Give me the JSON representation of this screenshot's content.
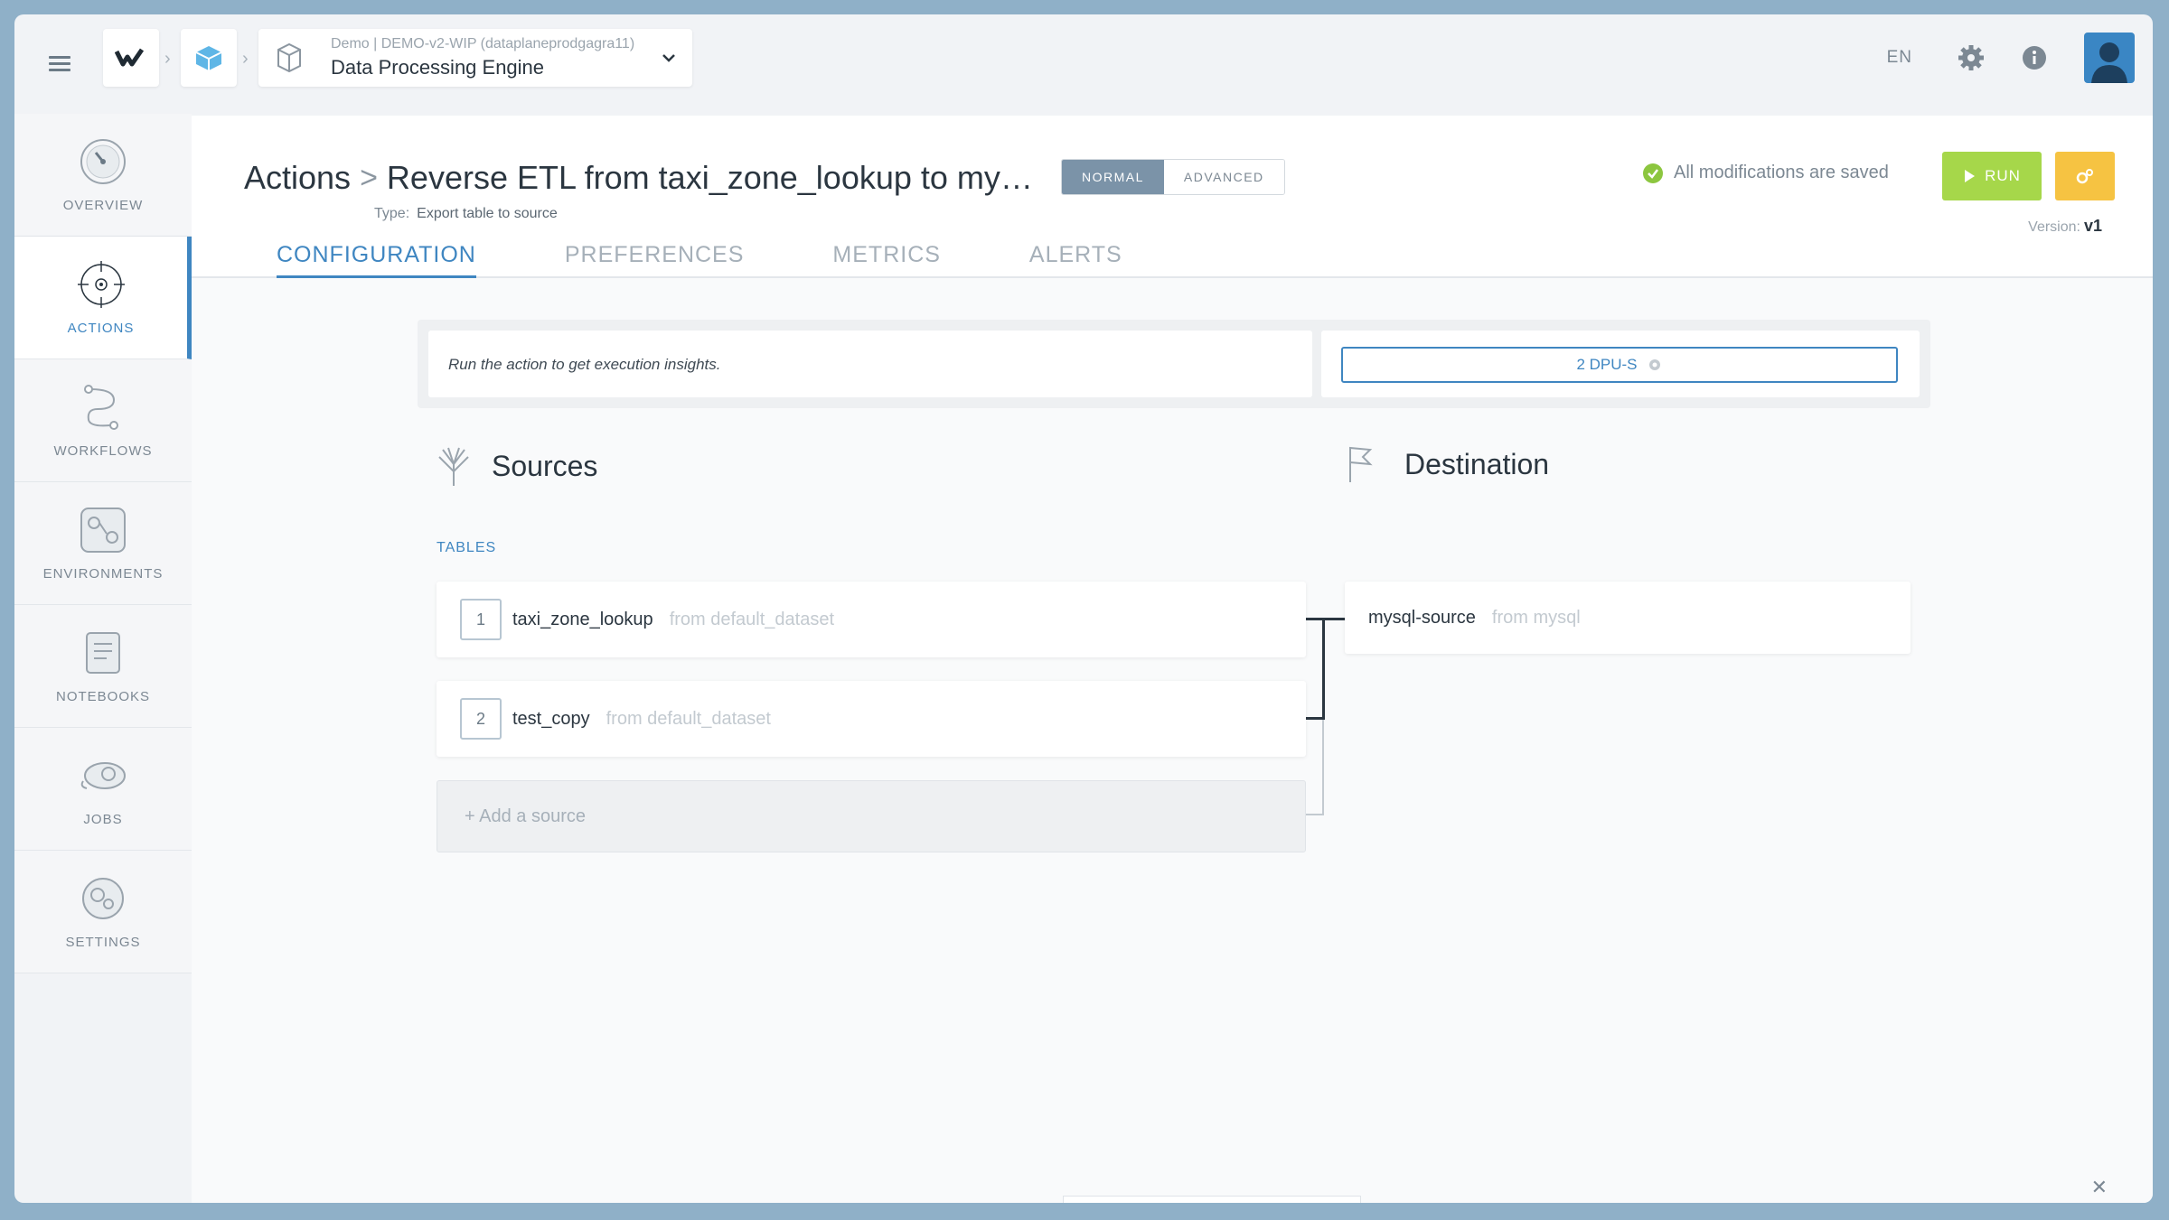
{
  "breadcrumb": {
    "org_sub": "Demo | DEMO-v2-WIP (dataplaneprodgagra11)",
    "project_title": "Data Processing Engine"
  },
  "topbar": {
    "lang": "EN"
  },
  "sidebar": {
    "items": [
      {
        "label": "OVERVIEW",
        "icon": "gauge-icon"
      },
      {
        "label": "ACTIONS",
        "icon": "target-icon",
        "active": true
      },
      {
        "label": "WORKFLOWS",
        "icon": "workflow-icon"
      },
      {
        "label": "ENVIRONMENTS",
        "icon": "environments-icon"
      },
      {
        "label": "NOTEBOOKS",
        "icon": "notebook-icon"
      },
      {
        "label": "JOBS",
        "icon": "jobs-icon"
      },
      {
        "label": "SETTINGS",
        "icon": "settings-gear-icon"
      }
    ]
  },
  "header": {
    "section": "Actions",
    "action_name": "Reverse ETL from taxi_zone_lookup to my…",
    "type_label": "Type:",
    "type_value": "Export table to source",
    "mode_normal": "NORMAL",
    "mode_advanced": "ADVANCED",
    "saved_status": "All modifications are saved",
    "run_label": "RUN",
    "version_label": "Version:",
    "version_value": "v1"
  },
  "tabs": [
    {
      "label": "CONFIGURATION",
      "active": true
    },
    {
      "label": "PREFERENCES"
    },
    {
      "label": "METRICS"
    },
    {
      "label": "ALERTS"
    }
  ],
  "insights": {
    "message": "Run the action to get execution insights.",
    "dpu_label": "2 DPU-S"
  },
  "sources": {
    "title": "Sources",
    "tables_label": "TABLES",
    "items": [
      {
        "num": "1",
        "name": "taxi_zone_lookup",
        "from": "from default_dataset"
      },
      {
        "num": "2",
        "name": "test_copy",
        "from": "from default_dataset"
      }
    ],
    "add_label": "+ Add a source"
  },
  "destination": {
    "title": "Destination",
    "name": "mysql-source",
    "from": "from mysql"
  },
  "colors": {
    "accent": "#3f86c1",
    "run": "#a6d74a",
    "schedule": "#f6c342",
    "saved": "#8cc63f"
  }
}
